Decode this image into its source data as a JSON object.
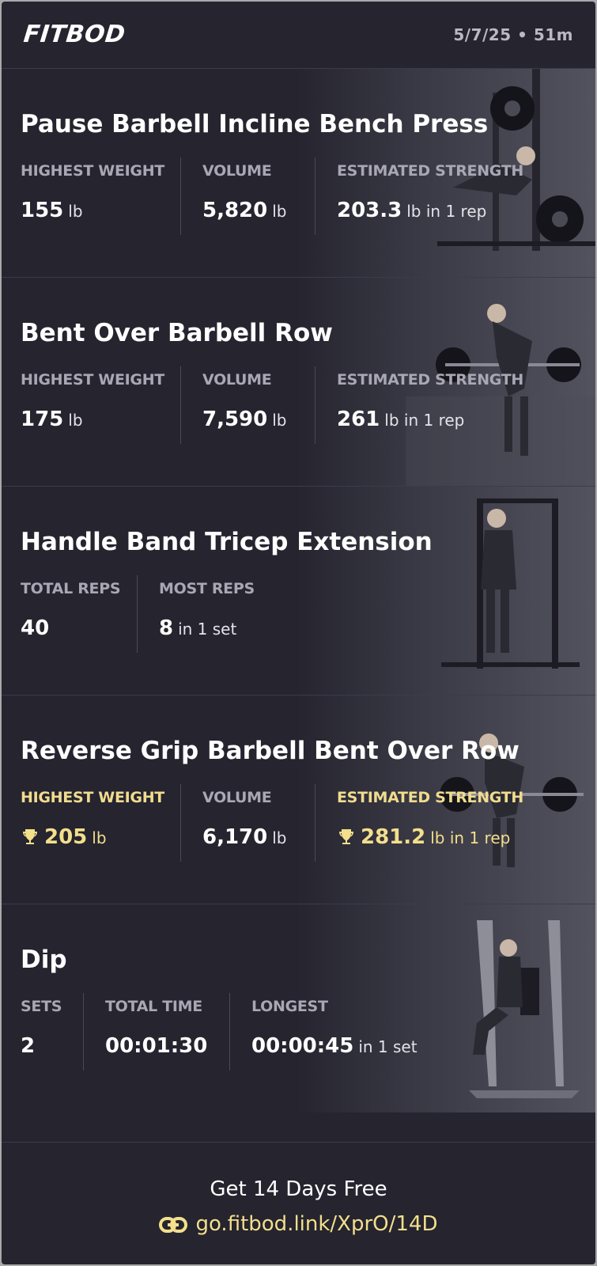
{
  "header": {
    "logo": "FITBOD",
    "meta": "5/7/25 • 51m"
  },
  "exercises": [
    {
      "name": "Pause Barbell Incline Bench Press",
      "stats": [
        {
          "label": "HIGHEST WEIGHT",
          "value": "155",
          "unit": "lb"
        },
        {
          "label": "VOLUME",
          "value": "5,820",
          "unit": "lb"
        },
        {
          "label": "ESTIMATED STRENGTH",
          "value": "203.3",
          "unit": "lb in 1 rep"
        }
      ]
    },
    {
      "name": "Bent Over Barbell Row",
      "stats": [
        {
          "label": "HIGHEST WEIGHT",
          "value": "175",
          "unit": "lb"
        },
        {
          "label": "VOLUME",
          "value": "7,590",
          "unit": "lb"
        },
        {
          "label": "ESTIMATED STRENGTH",
          "value": "261",
          "unit": "lb in 1 rep"
        }
      ]
    },
    {
      "name": "Handle Band Tricep Extension",
      "stats": [
        {
          "label": "TOTAL REPS",
          "value": "40",
          "unit": ""
        },
        {
          "label": "MOST REPS",
          "value": "8",
          "unit": "in 1 set"
        }
      ]
    },
    {
      "name": "Reverse Grip Barbell Bent Over Row",
      "stats": [
        {
          "label": "HIGHEST WEIGHT",
          "value": "205",
          "unit": "lb",
          "record": true
        },
        {
          "label": "VOLUME",
          "value": "6,170",
          "unit": "lb"
        },
        {
          "label": "ESTIMATED STRENGTH",
          "value": "281.2",
          "unit": "lb in 1 rep",
          "record": true
        }
      ]
    },
    {
      "name": "Dip",
      "stats": [
        {
          "label": "SETS",
          "value": "2",
          "unit": ""
        },
        {
          "label": "TOTAL TIME",
          "value": "00:01:30",
          "unit": ""
        },
        {
          "label": "LONGEST",
          "value": "00:00:45",
          "unit": "in 1 set"
        }
      ]
    }
  ],
  "footer": {
    "cta": "Get 14 Days Free",
    "link": "go.fitbod.link/XprO/14D",
    "link_icon": "link-icon"
  },
  "colors": {
    "background": "#25242f",
    "accent_gold": "#f3df8c",
    "label_gray": "#a8a7b3"
  },
  "icons": {
    "record": "trophy-icon"
  }
}
